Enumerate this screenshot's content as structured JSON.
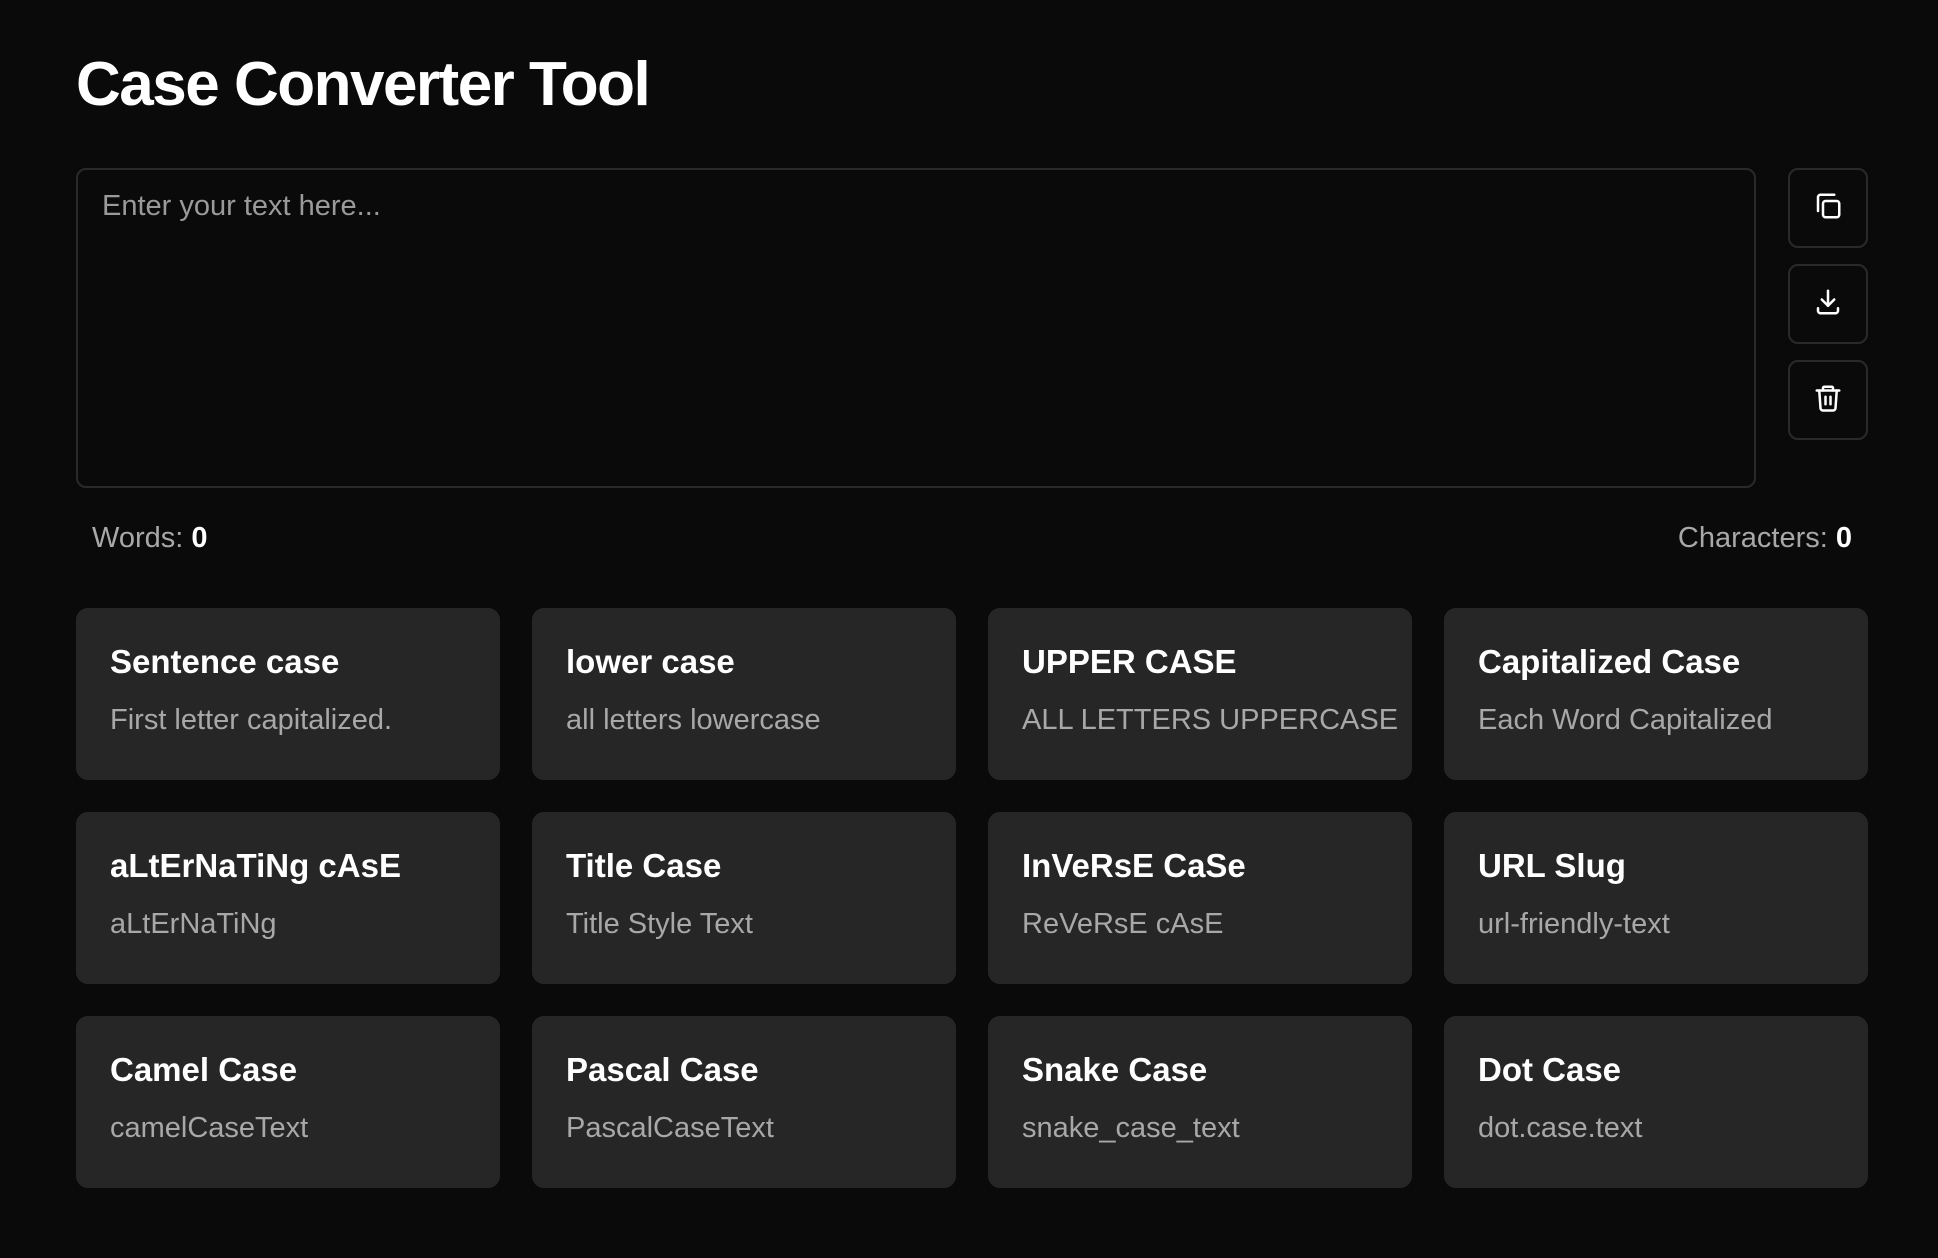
{
  "header": {
    "title": "Case Converter Tool"
  },
  "editor": {
    "placeholder": "Enter your text here...",
    "value": ""
  },
  "actions": [
    {
      "icon": "copy-icon",
      "label": "Copy"
    },
    {
      "icon": "download-icon",
      "label": "Download"
    },
    {
      "icon": "trash-icon",
      "label": "Clear"
    }
  ],
  "stats": {
    "words_label": "Words:",
    "words_value": "0",
    "chars_label": "Characters:",
    "chars_value": "0"
  },
  "cases": [
    {
      "title": "Sentence case",
      "desc": "First letter capitalized."
    },
    {
      "title": "lower case",
      "desc": "all letters lowercase"
    },
    {
      "title": "UPPER CASE",
      "desc": "ALL LETTERS UPPERCASE"
    },
    {
      "title": "Capitalized Case",
      "desc": "Each Word Capitalized"
    },
    {
      "title": "aLtErNaTiNg cAsE",
      "desc": "aLtErNaTiNg"
    },
    {
      "title": "Title Case",
      "desc": "Title Style Text"
    },
    {
      "title": "InVeRsE CaSe",
      "desc": "ReVeRsE cAsE"
    },
    {
      "title": "URL Slug",
      "desc": "url-friendly-text"
    },
    {
      "title": "Camel Case",
      "desc": "camelCaseText"
    },
    {
      "title": "Pascal Case",
      "desc": "PascalCaseText"
    },
    {
      "title": "Snake Case",
      "desc": "snake_case_text"
    },
    {
      "title": "Dot Case",
      "desc": "dot.case.text"
    }
  ]
}
